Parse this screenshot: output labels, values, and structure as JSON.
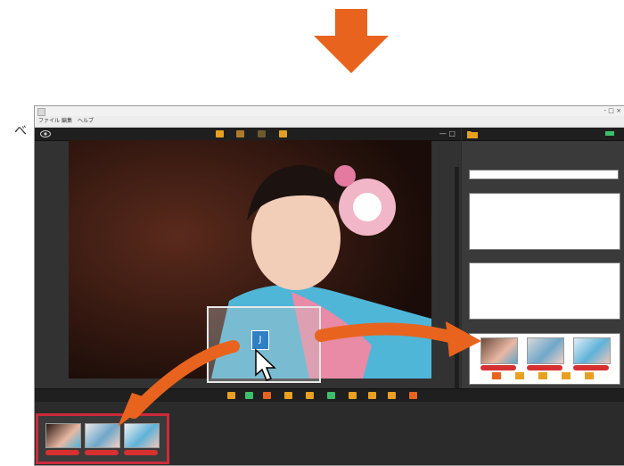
{
  "window": {
    "title": "",
    "controls": "- □ ×"
  },
  "menubar": {
    "items": [
      "ファイル",
      "編集",
      "ヘルプ"
    ],
    "right": "",
    "dot_icon": "●"
  },
  "viewer": {
    "label": "",
    "window_controls": "— □",
    "rating": "★ ★"
  },
  "drag_ghost": {
    "badge": "J"
  },
  "right_panel": {
    "title": "",
    "subheader": "",
    "input_value": "",
    "sections": [
      {
        "title": "",
        "right": ""
      },
      {
        "title": "",
        "right": ""
      },
      {
        "title": "",
        "right": ""
      }
    ],
    "thumbs": [
      {
        "label": ""
      },
      {
        "label": ""
      },
      {
        "label": ""
      }
    ]
  },
  "bottom": {
    "label": "",
    "status": ""
  },
  "filmstrip": {
    "thumbs": [
      {
        "label": ""
      },
      {
        "label": ""
      },
      {
        "label": ""
      }
    ]
  },
  "colors": {
    "accent_orange": "#e8641e",
    "frame_red": "#cc2a3a",
    "label_red": "#d63030"
  },
  "side_glyph": "ベ"
}
